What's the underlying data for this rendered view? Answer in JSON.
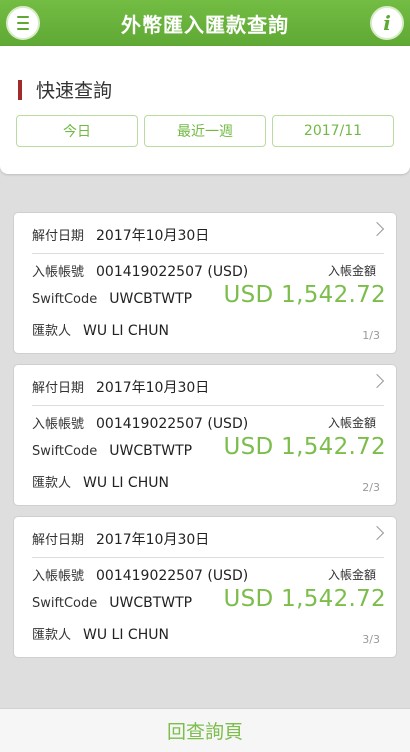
{
  "header": {
    "title": "外幣匯入匯款查詢",
    "info_label": "i"
  },
  "quick": {
    "title": "快速查詢",
    "buttons": [
      "今日",
      "最近一週",
      "2017/11"
    ]
  },
  "labels": {
    "date": "解付日期",
    "account": "入帳帳號",
    "swift": "SwiftCode",
    "remitter": "匯款人",
    "amount": "入帳金額"
  },
  "records": [
    {
      "date": "2017年10月30日",
      "account": "001419022507 (USD)",
      "swift": "UWCBTWTP",
      "remitter": "WU LI CHUN",
      "amount": "USD 1,542.72",
      "page": "1/3"
    },
    {
      "date": "2017年10月30日",
      "account": "001419022507 (USD)",
      "swift": "UWCBTWTP",
      "remitter": "WU LI CHUN",
      "amount": "USD 1,542.72",
      "page": "2/3"
    },
    {
      "date": "2017年10月30日",
      "account": "001419022507 (USD)",
      "swift": "UWCBTWTP",
      "remitter": "WU LI CHUN",
      "amount": "USD 1,542.72",
      "page": "3/3"
    }
  ],
  "footer": {
    "back_label": "回查詢頁"
  },
  "colors": {
    "brand_green": "#5ea834",
    "amount_green": "#7cbd4c",
    "accent_red": "#a32a2a"
  },
  "icons": {
    "menu": "menu-icon",
    "info": "info-icon",
    "chevron": "chevron-right-icon"
  }
}
